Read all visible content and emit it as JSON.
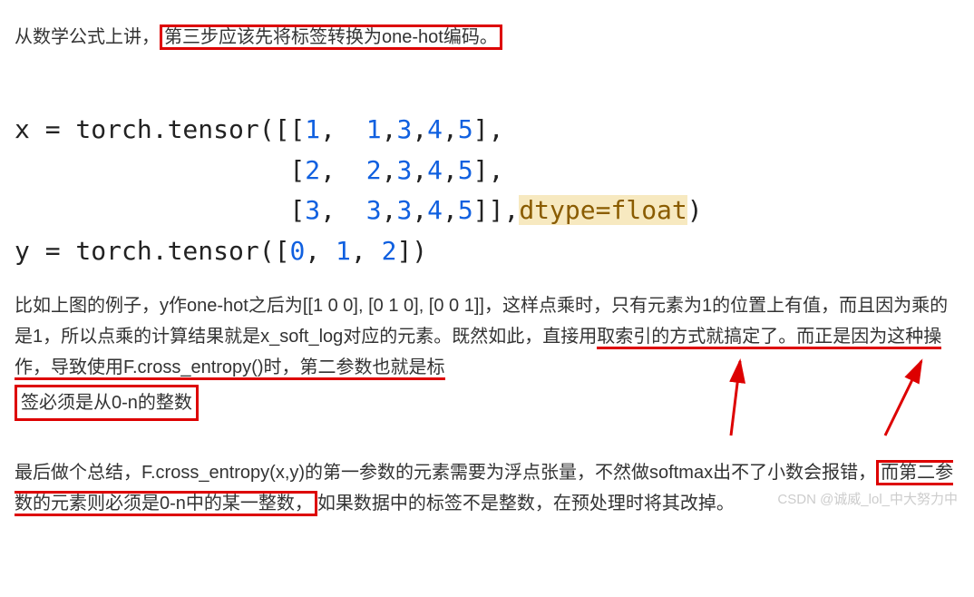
{
  "para1": {
    "before": "从数学公式上讲，",
    "highlight": "第三步应该先将标签转换为one-hot编码。"
  },
  "code": {
    "line1_a": "x = torch.tensor([[",
    "n1": "1",
    "c1": ",  ",
    "n2": "1",
    "c2": ",",
    "n3": "3",
    "c3": ",",
    "n4": "4",
    "c4": ",",
    "n5": "5",
    "l1end": "],",
    "line2_a": "                  [",
    "m1": "2",
    "d1": ",  ",
    "m2": "2",
    "d2": ",",
    "m3": "3",
    "d3": ",",
    "m4": "4",
    "d4": ",",
    "m5": "5",
    "l2end": "],",
    "line3_a": "                  [",
    "p1": "3",
    "e1": ",  ",
    "p2": "3",
    "e2": ",",
    "p3": "3",
    "e3": ",",
    "p4": "4",
    "e4": ",",
    "p5": "5",
    "l3end": "]],",
    "dtype_arg": "dtype=float",
    "l3close": ")",
    "line4_a": "y = torch.tensor([",
    "y1": "0",
    "yc1": ", ",
    "y2": "1",
    "yc2": ", ",
    "y3": "2",
    "l4end": "])"
  },
  "para2": {
    "t1": "比如上图的例子，y作one-hot之后为[[1 0 0], [0 1 0], [0 0 1]]，这样点乘时，只有元素为1的位置上有值，而且因为乘的是1，所以点乘的计算结果就是x_soft_log对应的元素。既然如此，直接用",
    "t2": "取索引的方式就搞定了。",
    "t3": "而正是因为这种操作，导致使用F.cross_entropy()时，第二参数也就是标",
    "t4": "签必须是从0-n的整数"
  },
  "para3": {
    "t1": "最后做个总结，F.cross_entropy(x,y)的第一参数的元素需要为浮点张量，不然做softmax出不了小数会报错，",
    "t2": "而第二参数的元素则必须是0-n中的某一整数，",
    "t3": "如果数据中的标签不是整数，在预处理时将其改掉。"
  },
  "watermark": "CSDN @诚威_lol_中大努力中"
}
